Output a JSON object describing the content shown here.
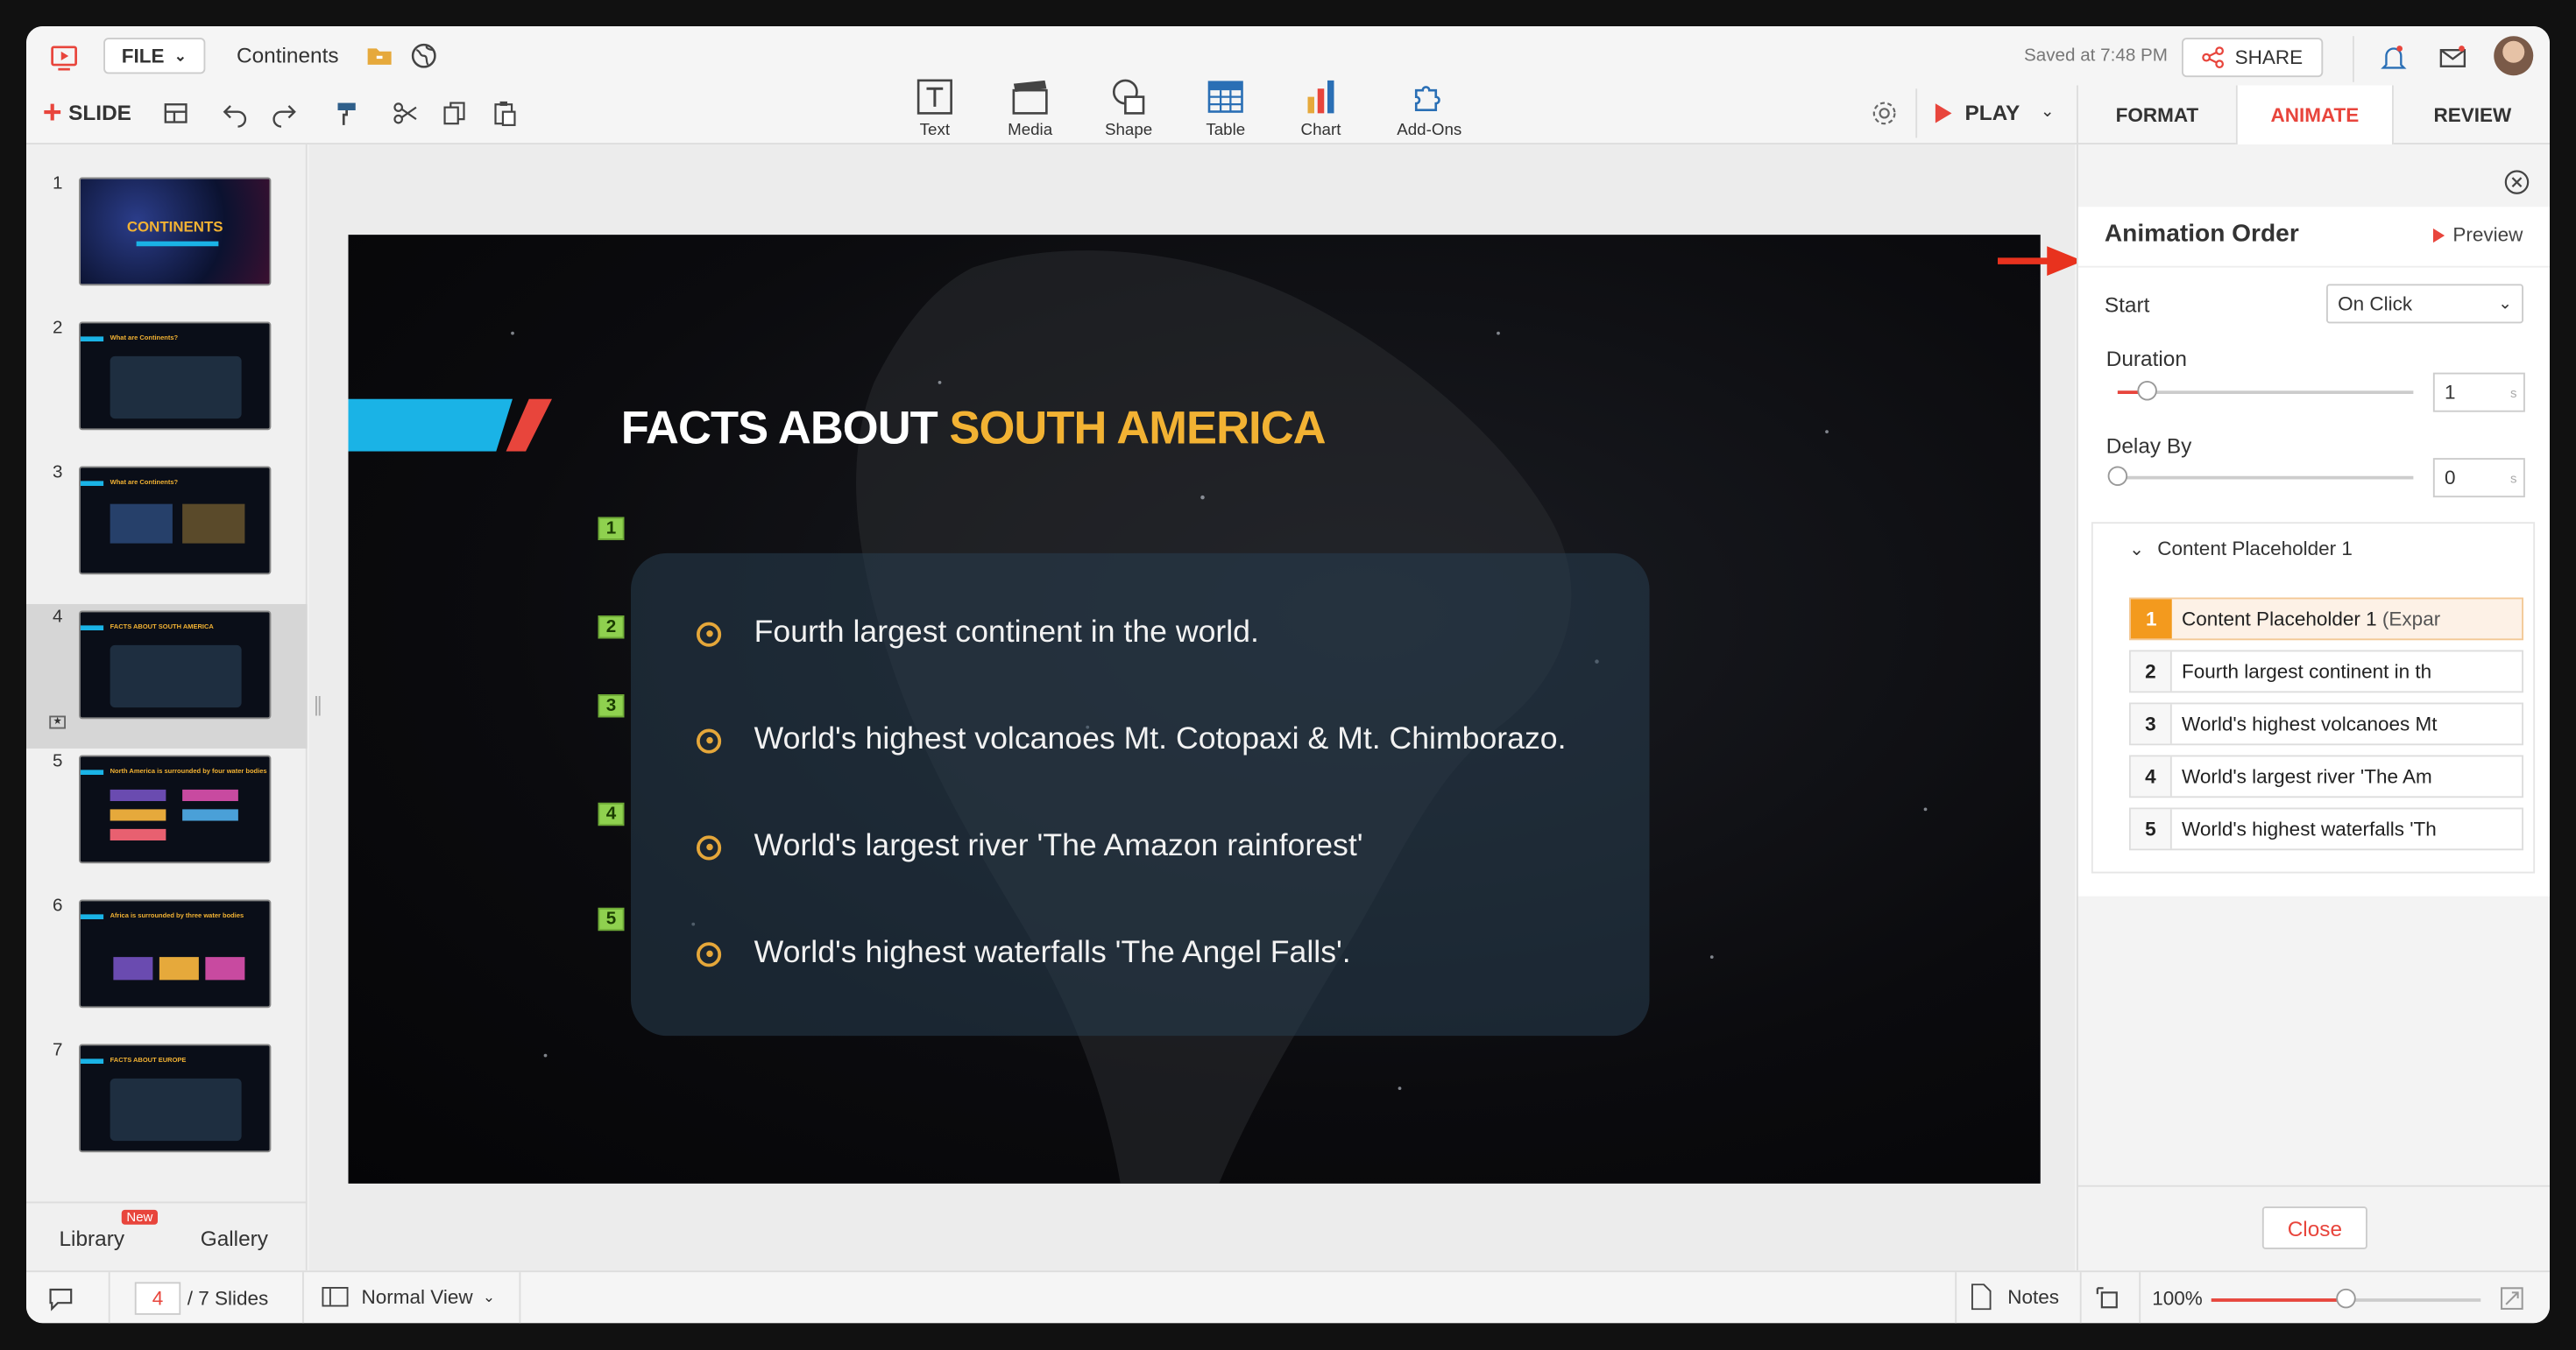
{
  "header": {
    "file_label": "FILE",
    "doc_title": "Continents",
    "saved_text": "Saved at 7:48 PM",
    "share_label": "SHARE"
  },
  "toolbar": {
    "slide_label": "SLIDE",
    "insert_tools": [
      {
        "label": "Text",
        "icon": "text-box-icon"
      },
      {
        "label": "Media",
        "icon": "clapperboard-icon"
      },
      {
        "label": "Shape",
        "icon": "shape-icon"
      },
      {
        "label": "Table",
        "icon": "table-icon"
      },
      {
        "label": "Chart",
        "icon": "bar-chart-icon"
      },
      {
        "label": "Add-Ons",
        "icon": "puzzle-icon"
      }
    ],
    "play_label": "PLAY"
  },
  "panel_tabs": [
    "FORMAT",
    "ANIMATE",
    "REVIEW"
  ],
  "active_tab": "ANIMATE",
  "slides": {
    "items": [
      {
        "number": "1",
        "title": "CONTINENTS"
      },
      {
        "number": "2",
        "title": "What are Continents?"
      },
      {
        "number": "3",
        "title": "What are Continents?"
      },
      {
        "number": "4",
        "title": "FACTS ABOUT SOUTH AMERICA"
      },
      {
        "number": "5",
        "title": "North America is surrounded by four water bodies"
      },
      {
        "number": "6",
        "title": "Africa is surrounded by three water bodies"
      },
      {
        "number": "7",
        "title": "FACTS ABOUT EUROPE"
      }
    ],
    "selected": 4,
    "library_label": "Library",
    "library_badge": "New",
    "gallery_label": "Gallery"
  },
  "slide": {
    "title_white": "FACTS ABOUT ",
    "title_yellow": "SOUTH AMERICA",
    "order_tags": [
      "1",
      "2",
      "3",
      "4",
      "5"
    ],
    "bullets": [
      "Fourth largest continent in the world.",
      "World's highest volcanoes Mt. Cotopaxi & Mt. Chimborazo.",
      "World's largest river 'The Amazon rainforest'",
      "World's highest waterfalls 'The Angel Falls'."
    ]
  },
  "animation": {
    "heading": "Animation Order",
    "preview_label": "Preview",
    "start_label": "Start",
    "start_value": "On Click",
    "duration_label": "Duration",
    "duration_value": "1",
    "duration_unit": "s",
    "duration_slider": 0.1,
    "delay_label": "Delay By",
    "delay_value": "0",
    "delay_unit": "s",
    "delay_slider": 0,
    "group_label": "Content Placeholder 1",
    "items": [
      {
        "n": "1",
        "text": "Content Placeholder 1",
        "suffix": "(Expar"
      },
      {
        "n": "2",
        "text": "Fourth largest continent in th"
      },
      {
        "n": "3",
        "text": "World's highest volcanoes Mt"
      },
      {
        "n": "4",
        "text": "World's largest river 'The Am"
      },
      {
        "n": "5",
        "text": "World's highest waterfalls 'Th"
      }
    ],
    "close_label": "Close"
  },
  "status": {
    "current_slide": "4",
    "total_slides": "/ 7 Slides",
    "view_label": "Normal View",
    "notes_label": "Notes",
    "zoom": "100%",
    "zoom_slider": 0.5
  },
  "colors": {
    "accent": "#e8453c",
    "slide_yellow": "#f2b233",
    "slide_cyan": "#1ab3e6",
    "order_badge": "#f39a1e",
    "tag_green": "#8fd14f"
  }
}
